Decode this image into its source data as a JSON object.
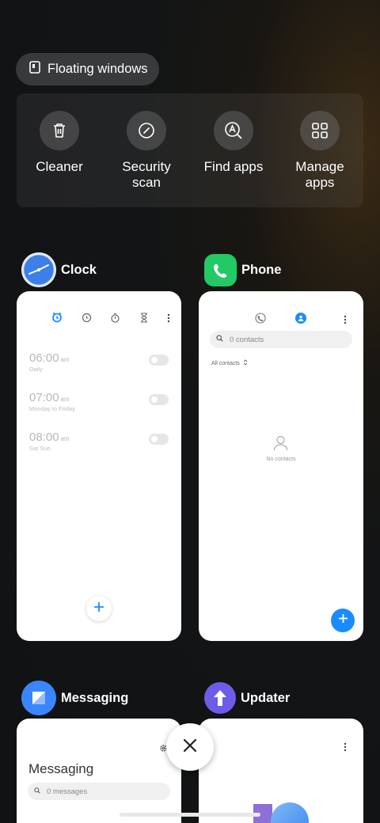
{
  "floating_windows": {
    "label": "Floating windows"
  },
  "quick_actions": [
    {
      "label": "Cleaner",
      "icon": "trash-icon"
    },
    {
      "label": "Security\nscan",
      "icon": "security-scan-icon"
    },
    {
      "label": "Find apps",
      "icon": "find-apps-icon"
    },
    {
      "label": "Manage\napps",
      "icon": "grid-icon"
    }
  ],
  "apps": {
    "clock": {
      "name": "Clock",
      "alarms": [
        {
          "time": "06:00",
          "ampm": "am",
          "repeat": "Daily"
        },
        {
          "time": "07:00",
          "ampm": "am",
          "repeat": "Monday to Friday"
        },
        {
          "time": "08:00",
          "ampm": "am",
          "repeat": "Sat Sun"
        }
      ]
    },
    "phone": {
      "name": "Phone",
      "search_placeholder": "0 contacts",
      "filter_label": "All contacts",
      "empty_text": "No contacts"
    },
    "messaging": {
      "name": "Messaging",
      "title": "Messaging",
      "search_placeholder": "0 messages"
    },
    "updater": {
      "name": "Updater"
    }
  },
  "colors": {
    "accent_blue": "#1a8cff",
    "phone_green": "#22c964",
    "updater_purple": "#6c5ce7"
  }
}
